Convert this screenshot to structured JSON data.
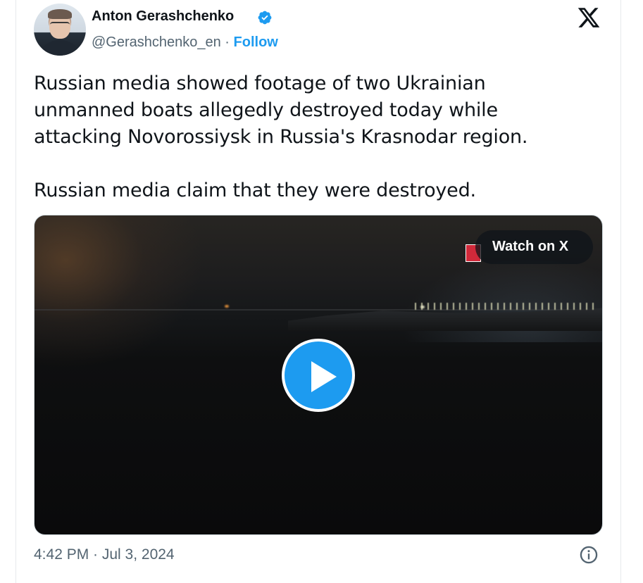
{
  "author": {
    "name": "Anton Gerashchenko",
    "handle": "@Gerashchenko_en",
    "separator": " · ",
    "follow_label": "Follow"
  },
  "tweet": {
    "text": "Russian media showed footage of two Ukrainian\nunmanned boats allegedly destroyed today while\nattacking Novorossiysk in Russia's Krasnodar region.\n\nRussian media claim that they were destroyed."
  },
  "media": {
    "watch_label": "Watch on X",
    "play_icon": "play-icon"
  },
  "footer": {
    "timestamp": "4:42 PM · Jul 3, 2024",
    "info_icon": "info-icon"
  },
  "colors": {
    "accent": "#1d9bf0",
    "text": "#0f1419",
    "muted": "#536471",
    "verified": "#1d9bf0"
  }
}
